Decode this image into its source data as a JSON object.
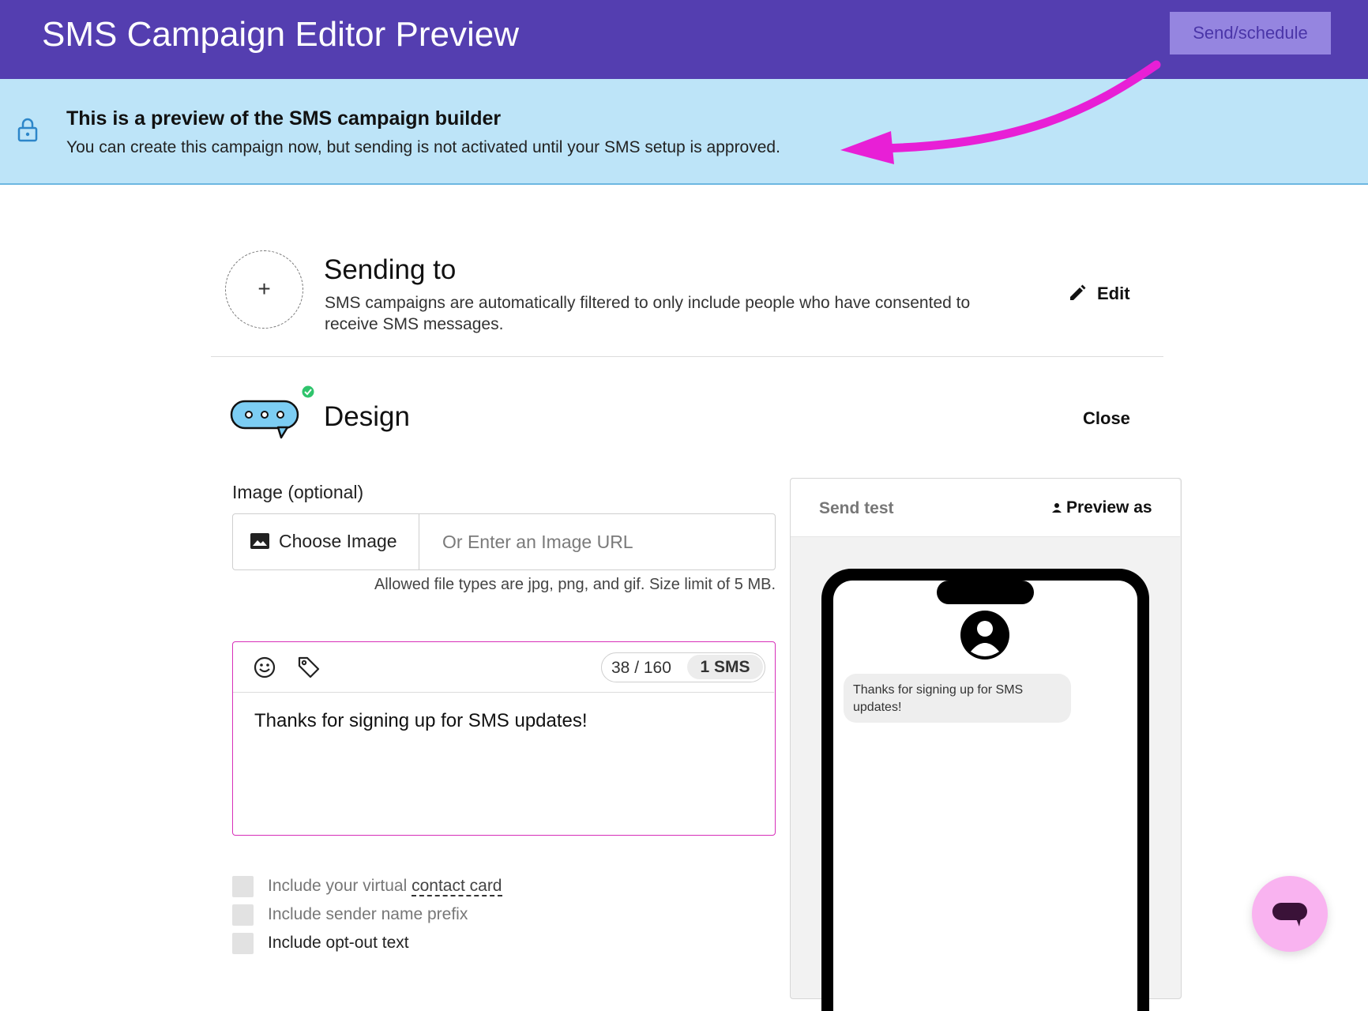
{
  "header": {
    "title": "SMS Campaign Editor Preview",
    "send_label": "Send/schedule"
  },
  "banner": {
    "title": "This is a preview of the SMS campaign builder",
    "text": "You can create this campaign now, but sending is not activated until your SMS setup is approved."
  },
  "sending": {
    "add_symbol": "+",
    "title": "Sending to",
    "description": "SMS campaigns are automatically filtered to only include people who have consented to receive SMS messages.",
    "edit_label": "Edit"
  },
  "design": {
    "title": "Design",
    "close_label": "Close"
  },
  "image": {
    "label": "Image (optional)",
    "choose_label": "Choose Image",
    "url_placeholder": "Or Enter an Image URL",
    "hint": "Allowed file types are jpg, png, and gif. Size limit of 5 MB."
  },
  "editor": {
    "count": "38 / 160",
    "sms_count": "1 SMS",
    "message": "Thanks for signing up for SMS updates!"
  },
  "options": {
    "contact_prefix": "Include your virtual ",
    "contact_link": "contact card",
    "sender_prefix": "Include sender name prefix",
    "optout": "Include opt-out text"
  },
  "preview": {
    "send_test_label": "Send test",
    "preview_as_label": "Preview as",
    "bubble_text": "Thanks for signing up for SMS updates!"
  },
  "colors": {
    "header_bg": "#543eb0",
    "banner_bg": "#bde4f8",
    "editor_border": "#d72fb9",
    "fab_bg": "#f9b3f0",
    "annotation_arrow": "#e81fd6"
  },
  "icons": [
    "lock-icon",
    "pencil-icon",
    "chat-bubble-icon",
    "check-badge-icon",
    "image-icon",
    "emoji-icon",
    "tag-icon",
    "person-icon",
    "avatar-icon",
    "chat-fab-icon"
  ]
}
